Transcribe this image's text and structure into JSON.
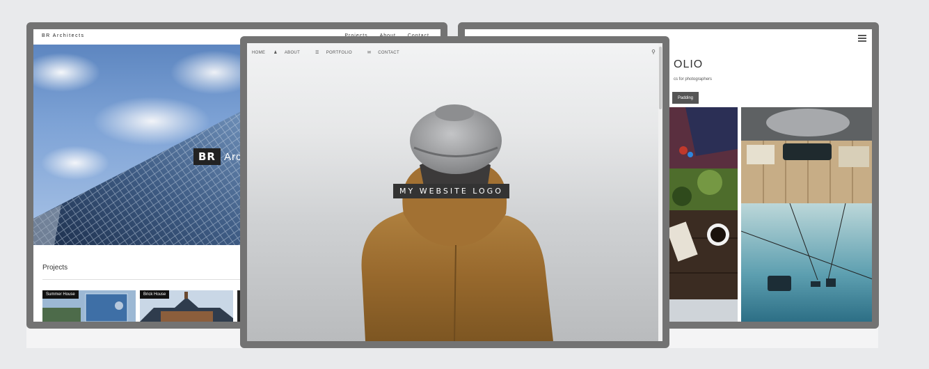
{
  "left_site": {
    "brand": "BR Architects",
    "menu": [
      "Projects",
      "About",
      "Contact"
    ],
    "hero_badge": "BR",
    "hero_badge_text": "Arc",
    "section_title": "Projects",
    "projects": [
      {
        "label": "Summer House"
      },
      {
        "label": "Brick House"
      }
    ]
  },
  "center_site": {
    "nav": [
      "HOME",
      "ABOUT",
      "PORTFOLIO",
      "CONTACT"
    ],
    "logo_text": "MY WEBSITE LOGO"
  },
  "right_site": {
    "title": "OLIO",
    "subtitle": "cs for photographers",
    "button_label": "Padding"
  },
  "colors": {
    "frame": "#737373",
    "background": "#e9eaec"
  }
}
